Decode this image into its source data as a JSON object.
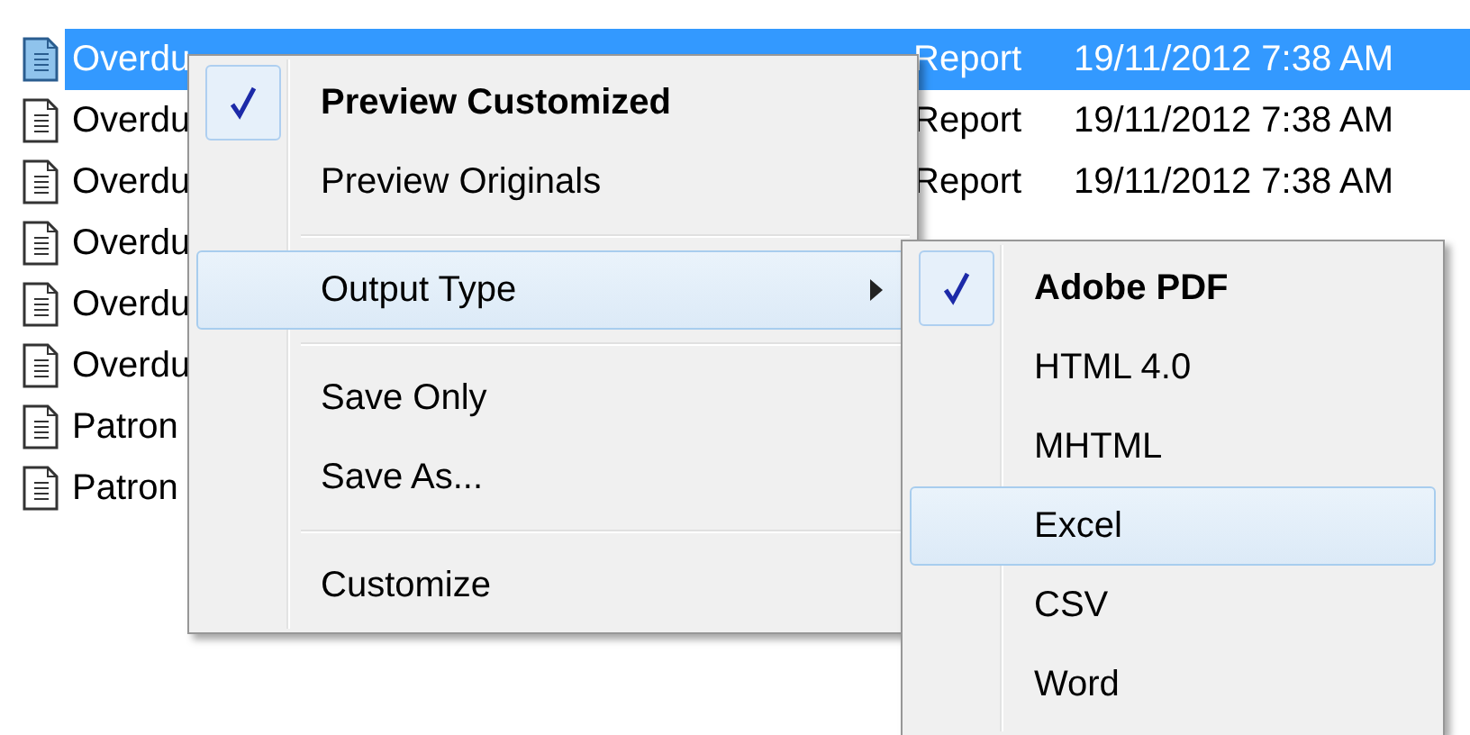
{
  "file_list": {
    "rows": [
      {
        "name": "Overdu",
        "type": "Report",
        "date": "19/11/2012 7:38 AM",
        "selected": true
      },
      {
        "name": "Overdu",
        "type": "Report",
        "date": "19/11/2012 7:38 AM",
        "selected": false
      },
      {
        "name": "Overdu",
        "type": "Report",
        "date": "19/11/2012 7:38 AM",
        "selected": false
      },
      {
        "name": "Overdu",
        "selected": false
      },
      {
        "name": "Overdu",
        "selected": false
      },
      {
        "name": "Overdu",
        "selected": false
      },
      {
        "name": "Patron",
        "selected": false
      },
      {
        "name": "Patron",
        "selected": false
      }
    ]
  },
  "context_menu": {
    "items": [
      {
        "kind": "item",
        "label": "Preview Customized",
        "checked": true,
        "default": true,
        "highlighted": false
      },
      {
        "kind": "item",
        "label": "Preview Originals",
        "checked": false,
        "default": false,
        "highlighted": false
      },
      {
        "kind": "separator"
      },
      {
        "kind": "item",
        "label": "Output Type",
        "checked": false,
        "default": false,
        "highlighted": true,
        "has_submenu": true
      },
      {
        "kind": "separator"
      },
      {
        "kind": "item",
        "label": "Save Only",
        "checked": false,
        "default": false,
        "highlighted": false
      },
      {
        "kind": "item",
        "label": "Save As...",
        "checked": false,
        "default": false,
        "highlighted": false
      },
      {
        "kind": "separator"
      },
      {
        "kind": "item",
        "label": "Customize",
        "checked": false,
        "default": false,
        "highlighted": false
      }
    ]
  },
  "submenu": {
    "items": [
      {
        "kind": "item",
        "label": "Adobe PDF",
        "checked": true,
        "default": true,
        "highlighted": false
      },
      {
        "kind": "item",
        "label": "HTML 4.0",
        "checked": false,
        "default": false,
        "highlighted": false
      },
      {
        "kind": "item",
        "label": "MHTML",
        "checked": false,
        "default": false,
        "highlighted": false
      },
      {
        "kind": "item",
        "label": "Excel",
        "checked": false,
        "default": false,
        "highlighted": true
      },
      {
        "kind": "item",
        "label": "CSV",
        "checked": false,
        "default": false,
        "highlighted": false
      },
      {
        "kind": "item",
        "label": "Word",
        "checked": false,
        "default": false,
        "highlighted": false
      }
    ]
  }
}
